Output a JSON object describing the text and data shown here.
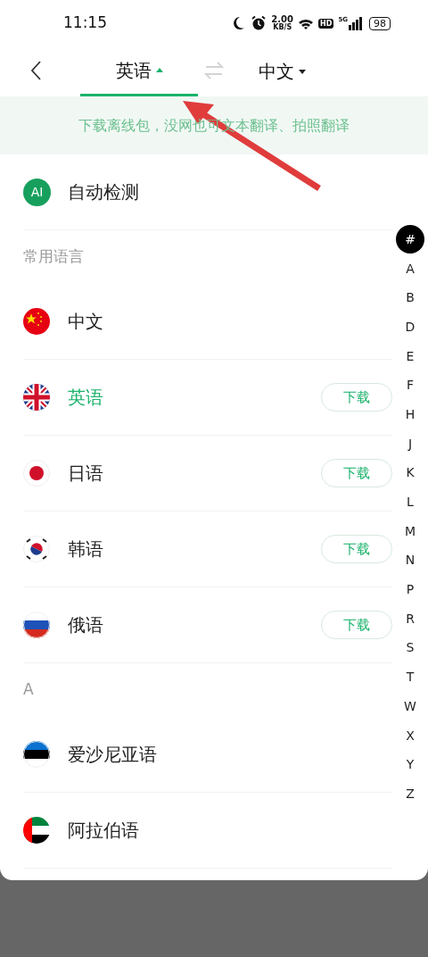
{
  "status_bar": {
    "time": "11:15",
    "speed": "2.00",
    "speed_unit": "KB/S",
    "hd": "HD",
    "network": "5G",
    "battery": "98"
  },
  "header": {
    "tabs": [
      {
        "label": "英语",
        "selected": true
      },
      {
        "label": "中文",
        "selected": false
      }
    ]
  },
  "banner": "下载离线包，没网也可文本翻译、拍照翻译",
  "auto_detect": {
    "badge": "AI",
    "label": "自动检测"
  },
  "sections": [
    {
      "title": "常用语言",
      "items": [
        {
          "name": "中文",
          "selected": false
        },
        {
          "name": "英语",
          "selected": true,
          "action": "下载"
        },
        {
          "name": "日语",
          "selected": false,
          "action": "下载"
        },
        {
          "name": "韩语",
          "selected": false,
          "action": "下载"
        },
        {
          "name": "俄语",
          "selected": false,
          "action": "下载"
        }
      ]
    },
    {
      "title": "A",
      "items": [
        {
          "name": "爱沙尼亚语",
          "selected": false
        },
        {
          "name": "阿拉伯语",
          "selected": false
        }
      ]
    }
  ],
  "index_bar": [
    {
      "label": "#",
      "selected": true
    },
    {
      "label": "A",
      "selected": false
    },
    {
      "label": "B",
      "selected": false
    },
    {
      "label": "D",
      "selected": false
    },
    {
      "label": "E",
      "selected": false
    },
    {
      "label": "F",
      "selected": false
    },
    {
      "label": "H",
      "selected": false
    },
    {
      "label": "J",
      "selected": false
    },
    {
      "label": "K",
      "selected": false
    },
    {
      "label": "L",
      "selected": false
    },
    {
      "label": "M",
      "selected": false
    },
    {
      "label": "N",
      "selected": false
    },
    {
      "label": "P",
      "selected": false
    },
    {
      "label": "R",
      "selected": false
    },
    {
      "label": "S",
      "selected": false
    },
    {
      "label": "T",
      "selected": false
    },
    {
      "label": "W",
      "selected": false
    },
    {
      "label": "X",
      "selected": false
    },
    {
      "label": "Y",
      "selected": false
    },
    {
      "label": "Z",
      "selected": false
    }
  ]
}
